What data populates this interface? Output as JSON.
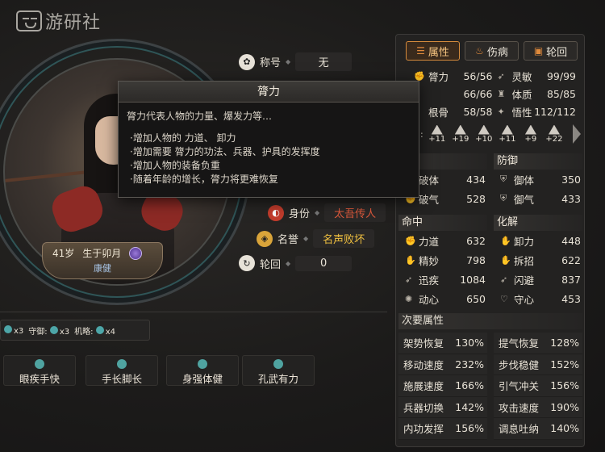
{
  "watermark": {
    "text": "游研社"
  },
  "portrait": {
    "age": "41岁",
    "birth": "生于卯月",
    "health": "康健"
  },
  "identity": {
    "title_label": "称号",
    "title_value": "无",
    "status_label": "身份",
    "status_value": "太吾传人",
    "fame_label": "名誉",
    "fame_value": "名声败坏",
    "samsara_label": "轮回",
    "samsara_value": "0"
  },
  "tooltip": {
    "title": "膂力",
    "desc": "膂力代表人物的力量、爆发力等…",
    "items": [
      "·增加人物的 力道、 卸力",
      "·增加需要 膂力的功法、兵器、护具的发挥度",
      "·增加人物的装备负重",
      "·随着年龄的增长，膂力将更难恢复"
    ]
  },
  "tabs": [
    {
      "label": "属性",
      "active": true
    },
    {
      "label": "伤病",
      "active": false
    },
    {
      "label": "轮回",
      "active": false
    }
  ],
  "main_attrs": [
    {
      "name": "膂力",
      "value": "56/56"
    },
    {
      "name": "灵敏",
      "value": "99/99"
    },
    {
      "name": "",
      "value": "66/66"
    },
    {
      "name": "体质",
      "value": "85/85"
    },
    {
      "name": "根骨",
      "value": "58/58"
    },
    {
      "name": "悟性",
      "value": "112/112"
    }
  ],
  "bonuses": {
    "label": "月:",
    "items": [
      "+11",
      "+19",
      "+10",
      "+11",
      "+9",
      "+22"
    ]
  },
  "attack": {
    "header": "",
    "rows": [
      {
        "name": "破体",
        "value": "434"
      },
      {
        "name": "破气",
        "value": "528"
      }
    ]
  },
  "defense": {
    "header": "防御",
    "rows": [
      {
        "name": "御体",
        "value": "350"
      },
      {
        "name": "御气",
        "value": "433"
      }
    ]
  },
  "hit": {
    "header": "命中",
    "rows": [
      {
        "name": "力道",
        "value": "632"
      },
      {
        "name": "精妙",
        "value": "798"
      },
      {
        "name": "迅疾",
        "value": "1084"
      },
      {
        "name": "动心",
        "value": "650"
      }
    ]
  },
  "resolve": {
    "header": "化解",
    "rows": [
      {
        "name": "卸力",
        "value": "448"
      },
      {
        "name": "拆招",
        "value": "622"
      },
      {
        "name": "闪避",
        "value": "837"
      },
      {
        "name": "守心",
        "value": "453"
      }
    ]
  },
  "secondary": {
    "header": "次要属性",
    "rows": [
      {
        "name": "架势恢复",
        "value": "130%"
      },
      {
        "name": "提气恢复",
        "value": "128%"
      },
      {
        "name": "移动速度",
        "value": "232%"
      },
      {
        "name": "步伐稳健",
        "value": "152%"
      },
      {
        "name": "施展速度",
        "value": "166%"
      },
      {
        "name": "引气冲关",
        "value": "156%"
      },
      {
        "name": "兵器切换",
        "value": "142%"
      },
      {
        "name": "攻击速度",
        "value": "190%"
      },
      {
        "name": "内功发挥",
        "value": "156%"
      },
      {
        "name": "调息吐纳",
        "value": "140%"
      }
    ]
  },
  "combat_bar": {
    "a_value": "x3",
    "guard_label": "守御:",
    "guard_value": "x3",
    "strategy_label": "机略:",
    "strategy_value": "x4"
  },
  "traits": [
    "眼疾手快",
    "手长脚长",
    "身强体健",
    "孔武有力"
  ],
  "colors": {
    "accent": "#d48a3c",
    "danger": "#e05a3c",
    "fame": "#f0c040",
    "teal": "#4da6a8"
  }
}
